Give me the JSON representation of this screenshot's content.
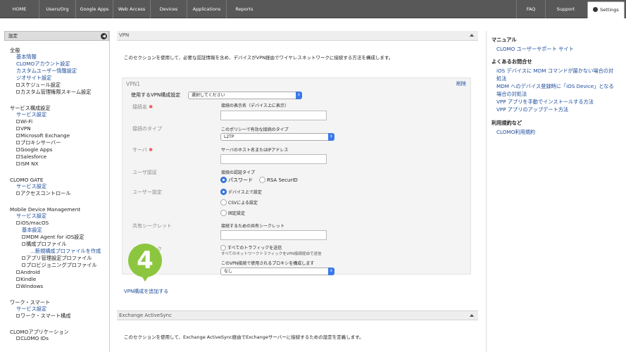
{
  "nav": {
    "home": "HOME",
    "users": "Users/Org",
    "google": "Google Apps",
    "web": "Web Access",
    "devices": "Devices",
    "apps": "Applications",
    "reports": "Reports",
    "faq": "FAQ",
    "support": "Support",
    "settings": "Settings"
  },
  "sidebar": {
    "header": "設定",
    "groups": [
      {
        "title": "全般",
        "items": [
          "基本情報",
          "CLOMOアカウント設定",
          "カスタムユーザー情報設定",
          "ジオサイト設定",
          "スケジュール設定",
          "カスタム管理権限スキーム設定"
        ]
      },
      {
        "title": "サービス構成設定",
        "items": [
          "サービス設定",
          "Wi-Fi",
          "VPN",
          "Microsoft Exchange",
          "プロキシサーバー",
          "Google Apps",
          "Salesforce",
          "ISM NX"
        ]
      },
      {
        "title": "CLOMO GATE",
        "items": [
          "サービス設定",
          "アクセスコントロール"
        ]
      },
      {
        "title": "Mobile Device Management",
        "items": [
          "サービス設定",
          "iOS/macOS",
          "基本設定",
          "MDM Agent for iOS設定",
          "構成プロファイル",
          "...新規構成プロファイルを作成",
          "アプリ管理設定プロファイル",
          "プロビジョニングプロファイル",
          "Android",
          "Kindle",
          "Windows"
        ]
      },
      {
        "title": "ワーク・スマート",
        "items": [
          "サービス設定",
          "ワーク・スマート構成"
        ]
      },
      {
        "title": "CLOMOアプリケーション",
        "items": [
          "CLOMO IDs"
        ]
      }
    ]
  },
  "main": {
    "vpn_header": "VPN",
    "vpn_desc": "このセクションを使用して、必要な認証情報を含め、デバイスがVPN経由でワイヤレスネットワークに接続する方法を構成します。",
    "vpn1_title": "VPN1",
    "delete": "削除",
    "use_config_label": "使用するVPN構成設定",
    "use_config_value": "選択してください",
    "conn_name_label": "接続名",
    "conn_name_hint": "接続の表示名（デバイス上に表示）",
    "conn_type_label": "接続のタイプ",
    "conn_type_hint": "このポリシーで有効な接続のタイプ",
    "conn_type_value": "L2TP",
    "server_label": "サーバ",
    "server_hint": "サーバのホスト名またはIPアドレス",
    "user_auth_label": "ユーザ認証",
    "user_auth_hint": "接続の認証タイプ",
    "auth_password": "パスワード",
    "auth_rsa": "RSA SecurID",
    "user_setting_label": "ユーザー設定",
    "user_opt1": "デバイス上で設定",
    "user_opt2": "CSVによる設定",
    "user_opt3": "固定設定",
    "secret_label": "共有シークレット",
    "secret_hint": "接続するための共有シークレット",
    "traffic_label": "トラフィック",
    "traffic_opt": "すべてのトラフィックを送信",
    "traffic_hint": "すべてのネットワークトラフィックをVPN接続経由で送信",
    "proxy_hint": "このVPN接続で使用されるプロキシを構成します",
    "proxy_value": "なし",
    "add_link": "VPN構成を追加する",
    "step_number": "4",
    "eas_header": "Exchange ActiveSync",
    "eas_desc": "このセクションを使用して、Exchange ActiveSync経由でExchangeサーバーに接続するための設定を定義します。"
  },
  "right": {
    "manual_title": "マニュアル",
    "manual_link": "CLOMO ユーザーサポート サイト",
    "faq_title": "よくあるお問合せ",
    "faq_links": [
      "iOS デバイスに MDM コマンドが届かない場合の対",
      "処法",
      "MDM へのデバイス登録時に「iOS Device」となる",
      "場合の対処法",
      "VPP アプリを手動でインストールする方法",
      "VPP アプリのアップデート方法"
    ],
    "terms_title": "利用規約など",
    "terms_link": "CLOMO利用規約"
  }
}
